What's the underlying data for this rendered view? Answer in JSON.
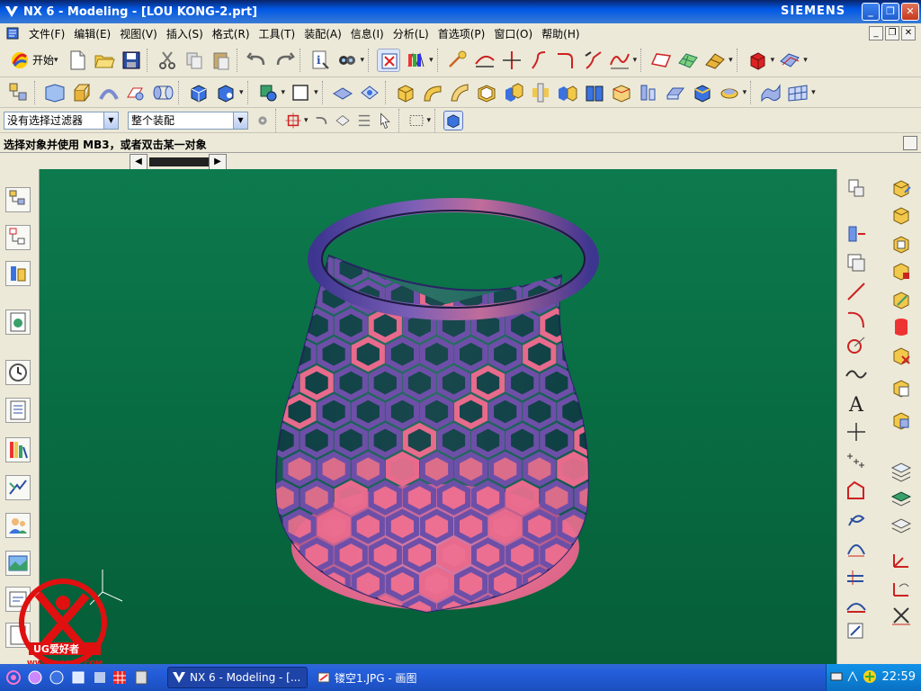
{
  "window": {
    "title": "NX 6 - Modeling - [LOU KONG-2.prt]",
    "brand": "SIEMENS",
    "buttons": {
      "minimize": "_",
      "restore": "❐",
      "close": "✕"
    }
  },
  "menubar": {
    "items": [
      {
        "label": "文件(F)"
      },
      {
        "label": "编辑(E)"
      },
      {
        "label": "视图(V)"
      },
      {
        "label": "插入(S)"
      },
      {
        "label": "格式(R)"
      },
      {
        "label": "工具(T)"
      },
      {
        "label": "装配(A)"
      },
      {
        "label": "信息(I)"
      },
      {
        "label": "分析(L)"
      },
      {
        "label": "首选项(P)"
      },
      {
        "label": "窗口(O)"
      },
      {
        "label": "帮助(H)"
      }
    ]
  },
  "toolbar": {
    "start_label": "开始",
    "filter": {
      "value": "没有选择过滤器"
    },
    "scope": {
      "value": "整个装配"
    }
  },
  "cue_line": "选择对象并使用 MB3，或者双击某一对象",
  "watermark": {
    "text": "UG爱好者",
    "url": "WWW.UGSNX.COM"
  },
  "taskbar": {
    "tasks": [
      {
        "label": "NX 6 - Modeling - [..."
      },
      {
        "label": "镂空1.JPG - 画图"
      }
    ],
    "clock": "22:59"
  },
  "colors": {
    "viewport_bg": "#087046",
    "model_body": "#6e4fa8",
    "model_highlight": "#e86a8c",
    "model_base": "#ef6f8f"
  },
  "icons": {
    "start": "nx-start-icon",
    "file_new": "new-file-icon",
    "file_open": "open-folder-icon",
    "file_save": "save-disk-icon"
  }
}
